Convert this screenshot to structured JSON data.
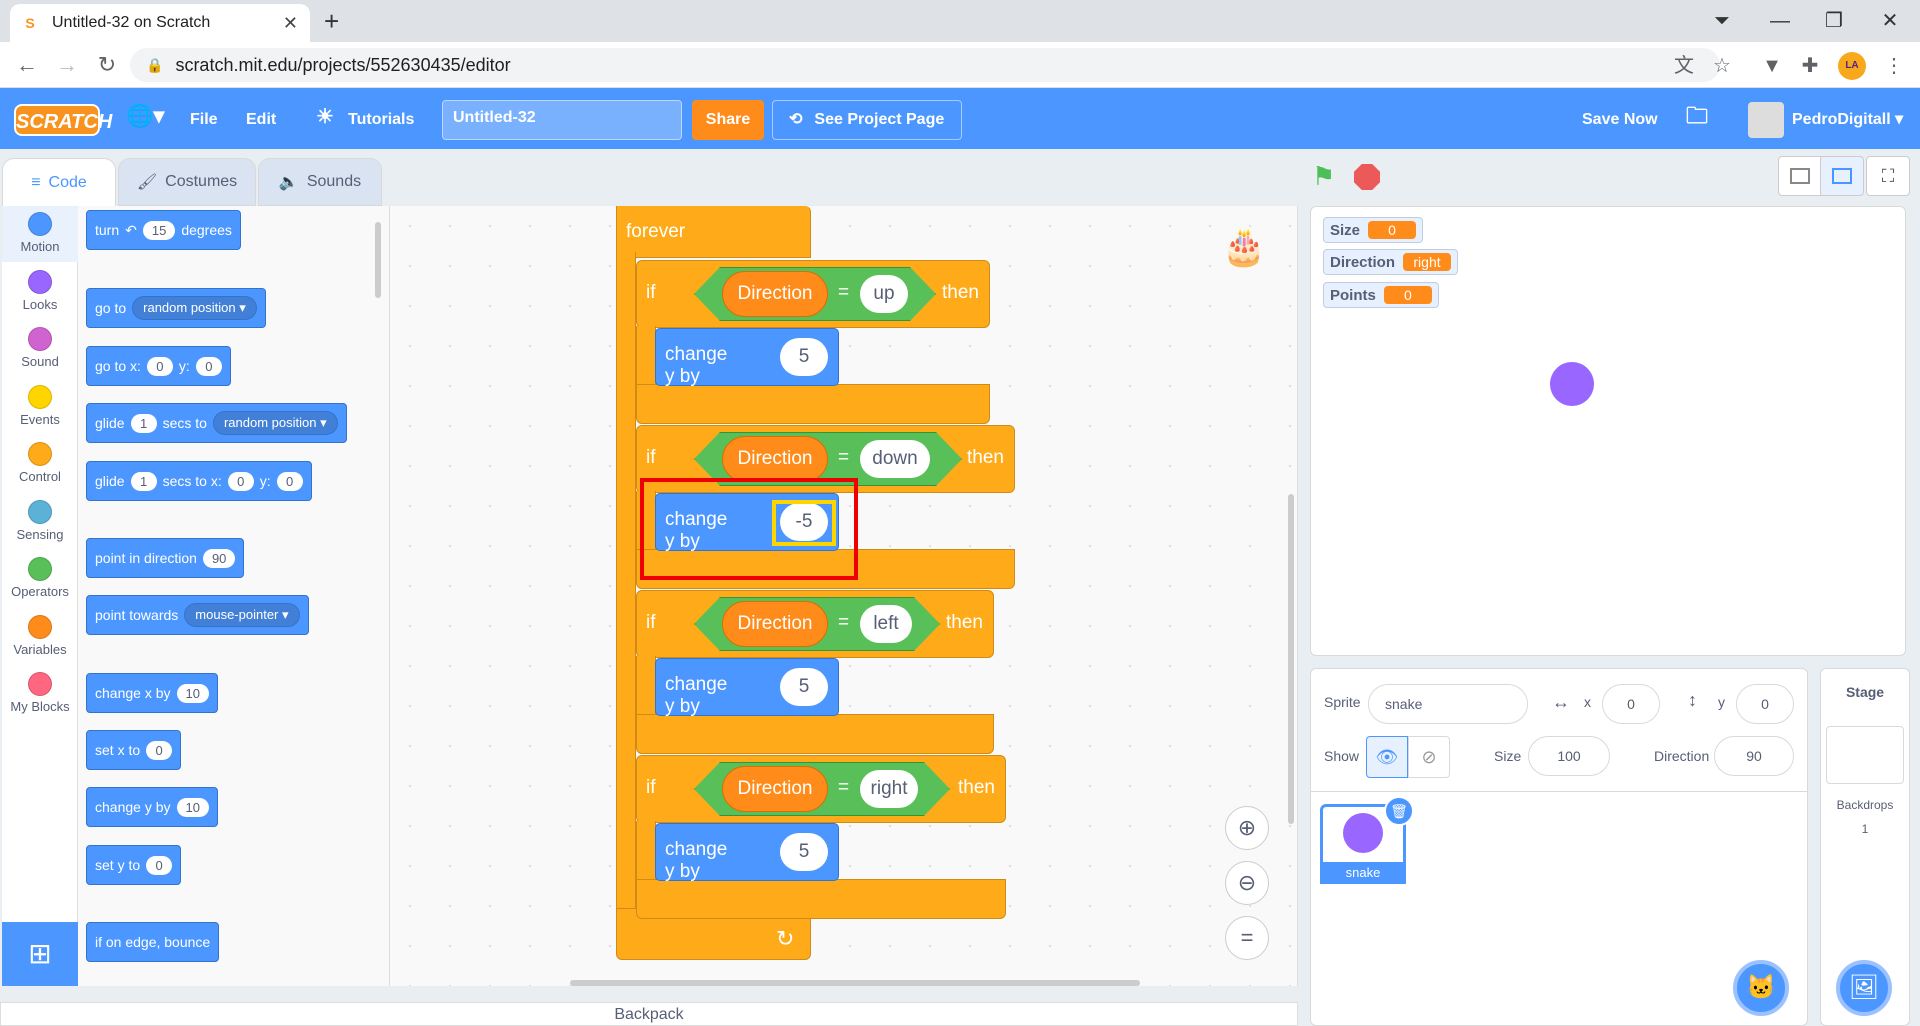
{
  "browser": {
    "tab_title": "Untitled-32 on Scratch",
    "url": "scratch.mit.edu/projects/552630435/editor"
  },
  "menubar": {
    "logo": "SCRATCH",
    "file": "File",
    "edit": "Edit",
    "tutorials": "Tutorials",
    "project_title": "Untitled-32",
    "share": "Share",
    "see_project_page": "See Project Page",
    "save_now": "Save Now",
    "username": "PedroDigitall"
  },
  "tabs": {
    "code": "Code",
    "costumes": "Costumes",
    "sounds": "Sounds"
  },
  "categories": [
    {
      "label": "Motion",
      "color": "#4c97ff"
    },
    {
      "label": "Looks",
      "color": "#9966ff"
    },
    {
      "label": "Sound",
      "color": "#cf63cf"
    },
    {
      "label": "Events",
      "color": "#ffd500"
    },
    {
      "label": "Control",
      "color": "#ffab19"
    },
    {
      "label": "Sensing",
      "color": "#5cb1d6"
    },
    {
      "label": "Operators",
      "color": "#59c059"
    },
    {
      "label": "Variables",
      "color": "#ff8c1a"
    },
    {
      "label": "My Blocks",
      "color": "#ff6680"
    }
  ],
  "palette": {
    "turn": "turn",
    "turn_val": "15",
    "degrees": "degrees",
    "goto": "go to",
    "random_position": "random position",
    "goto_xy": "go to x:",
    "zero": "0",
    "y": "y:",
    "glide": "glide",
    "one": "1",
    "secs_to": "secs to",
    "secs_to_x": "secs to x:",
    "point_in_direction": "point in direction",
    "ninety": "90",
    "point_towards": "point towards",
    "mouse_pointer": "mouse-pointer",
    "change_x_by": "change x by",
    "ten": "10",
    "set_x_to": "set x to",
    "change_y_by": "change y by",
    "set_y_to": "set y to",
    "if_on_edge_bounce": "if on edge, bounce"
  },
  "script": {
    "forever": "forever",
    "if": "if",
    "then": "then",
    "equals": "=",
    "direction_var": "Direction",
    "change_y_by": "change y by",
    "conds": [
      "up",
      "down",
      "left",
      "right"
    ],
    "values": [
      "5",
      "-5",
      "5",
      "5"
    ]
  },
  "backpack": "Backpack",
  "monitors": [
    {
      "name": "Size",
      "value": "0"
    },
    {
      "name": "Direction",
      "value": "right"
    },
    {
      "name": "Points",
      "value": "0"
    }
  ],
  "sprite_info": {
    "sprite_label": "Sprite",
    "sprite_name": "snake",
    "x_label": "x",
    "x": "0",
    "y_label": "y",
    "y": "0",
    "show_label": "Show",
    "size_label": "Size",
    "size": "100",
    "direction_label": "Direction",
    "direction": "90",
    "thumb_name": "snake"
  },
  "stage_pane": {
    "title": "Stage",
    "backdrops_label": "Backdrops",
    "backdrops_count": "1"
  },
  "colors": {
    "accent": "#4c97ff",
    "control": "#ffab19",
    "operators": "#59c059",
    "variables": "#ff8c1a",
    "sprite": "#9966ff"
  }
}
